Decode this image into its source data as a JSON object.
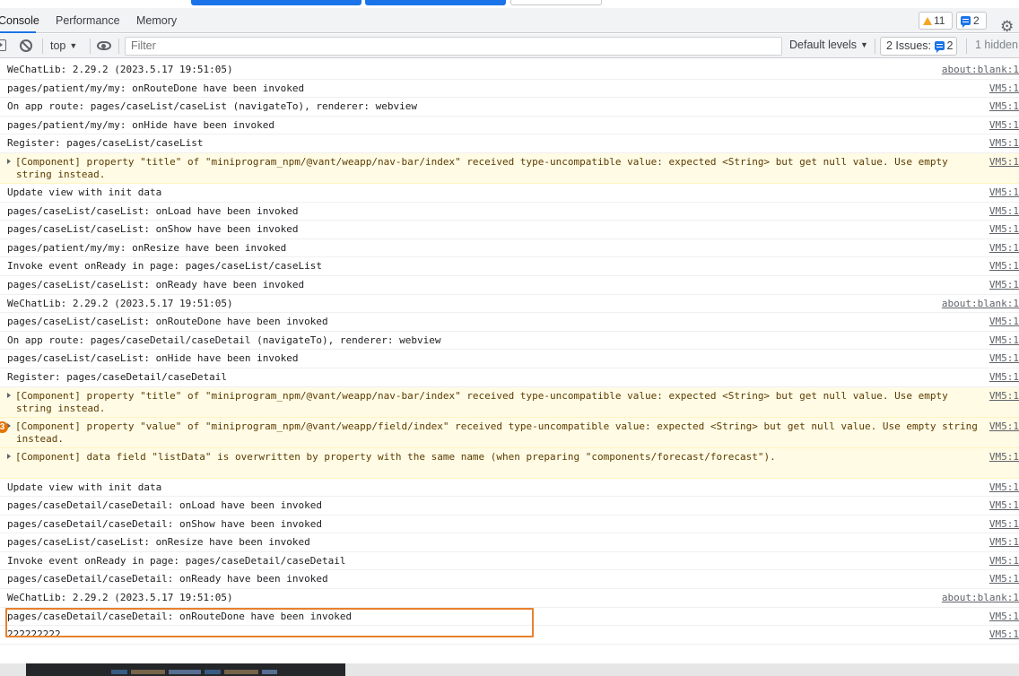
{
  "tabs": [
    {
      "label": "Console",
      "active": true
    },
    {
      "label": "Performance",
      "active": false
    },
    {
      "label": "Memory",
      "active": false
    }
  ],
  "badges": {
    "warnings": "11",
    "messages": "2"
  },
  "toolbar": {
    "context": "top",
    "filter_placeholder": "Filter",
    "levels": "Default levels",
    "issues_label": "2 Issues:",
    "issues_count": "2",
    "hidden": "1 hidden"
  },
  "log": [
    {
      "type": "log",
      "text": "WeChatLib: 2.29.2 (2023.5.17 19:51:05)",
      "source": "about:blank:1"
    },
    {
      "type": "log",
      "text": "pages/patient/my/my: onRouteDone have been invoked",
      "source": "VM5:1"
    },
    {
      "type": "log",
      "text": "On app route: pages/caseList/caseList (navigateTo), renderer: webview",
      "source": "VM5:1"
    },
    {
      "type": "log",
      "text": "pages/patient/my/my: onHide have been invoked",
      "source": "VM5:1"
    },
    {
      "type": "log",
      "text": "Register: pages/caseList/caseList",
      "source": "VM5:1"
    },
    {
      "type": "warn",
      "text": "[Component] property \"title\" of \"miniprogram_npm/@vant/weapp/nav-bar/index\" received type-uncompatible value: expected <String> but get null value. Use empty string instead.",
      "source": "VM5:1"
    },
    {
      "type": "log",
      "text": "Update view with init data",
      "source": "VM5:1"
    },
    {
      "type": "log",
      "text": "pages/caseList/caseList: onLoad have been invoked",
      "source": "VM5:1"
    },
    {
      "type": "log",
      "text": "pages/caseList/caseList: onShow have been invoked",
      "source": "VM5:1"
    },
    {
      "type": "log",
      "text": "pages/patient/my/my: onResize have been invoked",
      "source": "VM5:1"
    },
    {
      "type": "log",
      "text": "Invoke event onReady in page: pages/caseList/caseList",
      "source": "VM5:1"
    },
    {
      "type": "log",
      "text": "pages/caseList/caseList: onReady have been invoked",
      "source": "VM5:1"
    },
    {
      "type": "log",
      "text": "WeChatLib: 2.29.2 (2023.5.17 19:51:05)",
      "source": "about:blank:1"
    },
    {
      "type": "log",
      "text": "pages/caseList/caseList: onRouteDone have been invoked",
      "source": "VM5:1"
    },
    {
      "type": "log",
      "text": "On app route: pages/caseDetail/caseDetail (navigateTo), renderer: webview",
      "source": "VM5:1"
    },
    {
      "type": "log",
      "text": "pages/caseList/caseList: onHide have been invoked",
      "source": "VM5:1"
    },
    {
      "type": "log",
      "text": "Register: pages/caseDetail/caseDetail",
      "source": "VM5:1"
    },
    {
      "type": "warn",
      "text": "[Component] property \"title\" of \"miniprogram_npm/@vant/weapp/nav-bar/index\" received type-uncompatible value: expected <String> but get null value. Use empty string instead.",
      "source": "VM5:1"
    },
    {
      "type": "warn",
      "count": "3",
      "text": "[Component] property \"value\" of \"miniprogram_npm/@vant/weapp/field/index\" received type-uncompatible value: expected <String> but get null value. Use empty string instead.",
      "source": "VM5:1"
    },
    {
      "type": "warn",
      "text": "[Component] data field \"listData\" is overwritten by property with the same name (when preparing \"components/forecast/forecast\").",
      "source": "VM5:1"
    },
    {
      "type": "log",
      "text": "Update view with init data",
      "source": "VM5:1"
    },
    {
      "type": "log",
      "text": "pages/caseDetail/caseDetail: onLoad have been invoked",
      "source": "VM5:1"
    },
    {
      "type": "log",
      "text": "pages/caseDetail/caseDetail: onShow have been invoked",
      "source": "VM5:1"
    },
    {
      "type": "log",
      "text": "pages/caseList/caseList: onResize have been invoked",
      "source": "VM5:1"
    },
    {
      "type": "log",
      "text": "Invoke event onReady in page: pages/caseDetail/caseDetail",
      "source": "VM5:1"
    },
    {
      "type": "log",
      "text": "pages/caseDetail/caseDetail: onReady have been invoked",
      "source": "VM5:1"
    },
    {
      "type": "log",
      "text": "WeChatLib: 2.29.2 (2023.5.17 19:51:05)",
      "source": "about:blank:1"
    },
    {
      "type": "log",
      "text": "pages/caseDetail/caseDetail: onRouteDone have been invoked",
      "source": "VM5:1"
    },
    {
      "type": "log",
      "text": "222222222",
      "source": "VM5:1",
      "highlighted": true
    }
  ],
  "colors": {
    "accent": "#1a73e8",
    "warning_bg": "#fffbe5",
    "highlight_box": "#e8812e",
    "count_badge": "#e37400"
  }
}
